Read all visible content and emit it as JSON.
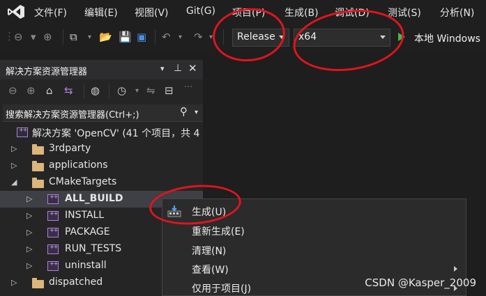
{
  "menu": {
    "items": [
      "文件(F)",
      "编辑(E)",
      "视图(V)",
      "Git(G)",
      "项目(P)",
      "生成(B)",
      "调试(D)",
      "测试(S)",
      "分析(N)"
    ]
  },
  "toolbar": {
    "config_value": "Release",
    "platform_value": "x64",
    "run_label": "本地 Windows"
  },
  "solution_explorer": {
    "title": "解决方案资源管理器",
    "title_pin": "▾ 📌 ✕",
    "search_placeholder": "搜索解决方案资源管理器(Ctrl+;)",
    "solution_label": "解决方案 'OpenCV' (41 个项目，共 4",
    "tree": [
      {
        "label": "3rdparty",
        "kind": "folder",
        "expander": "▷"
      },
      {
        "label": "applications",
        "kind": "folder",
        "expander": "▷"
      },
      {
        "label": "CMakeTargets",
        "kind": "folder",
        "expander": "◢"
      },
      {
        "label": "ALL_BUILD",
        "kind": "project",
        "expander": "▷",
        "selected": true
      },
      {
        "label": "INSTALL",
        "kind": "project",
        "expander": "▷"
      },
      {
        "label": "PACKAGE",
        "kind": "project",
        "expander": "▷"
      },
      {
        "label": "RUN_TESTS",
        "kind": "project",
        "expander": "▷"
      },
      {
        "label": "uninstall",
        "kind": "project",
        "expander": "▷"
      },
      {
        "label": "dispatched",
        "kind": "folder",
        "expander": "▷"
      }
    ]
  },
  "context_menu": {
    "items": [
      {
        "label": "生成(U)"
      },
      {
        "label": "重新生成(E)"
      },
      {
        "label": "清理(N)"
      },
      {
        "label": "查看(W)",
        "submenu": true
      },
      {
        "label": "仅用于项目(J)",
        "submenu": true
      }
    ]
  },
  "watermark": "CSDN @Kasper_2009",
  "colors": {
    "accent_red": "#e0141e",
    "vs_purple": "#b180d7",
    "folder": "#dcb67a"
  }
}
